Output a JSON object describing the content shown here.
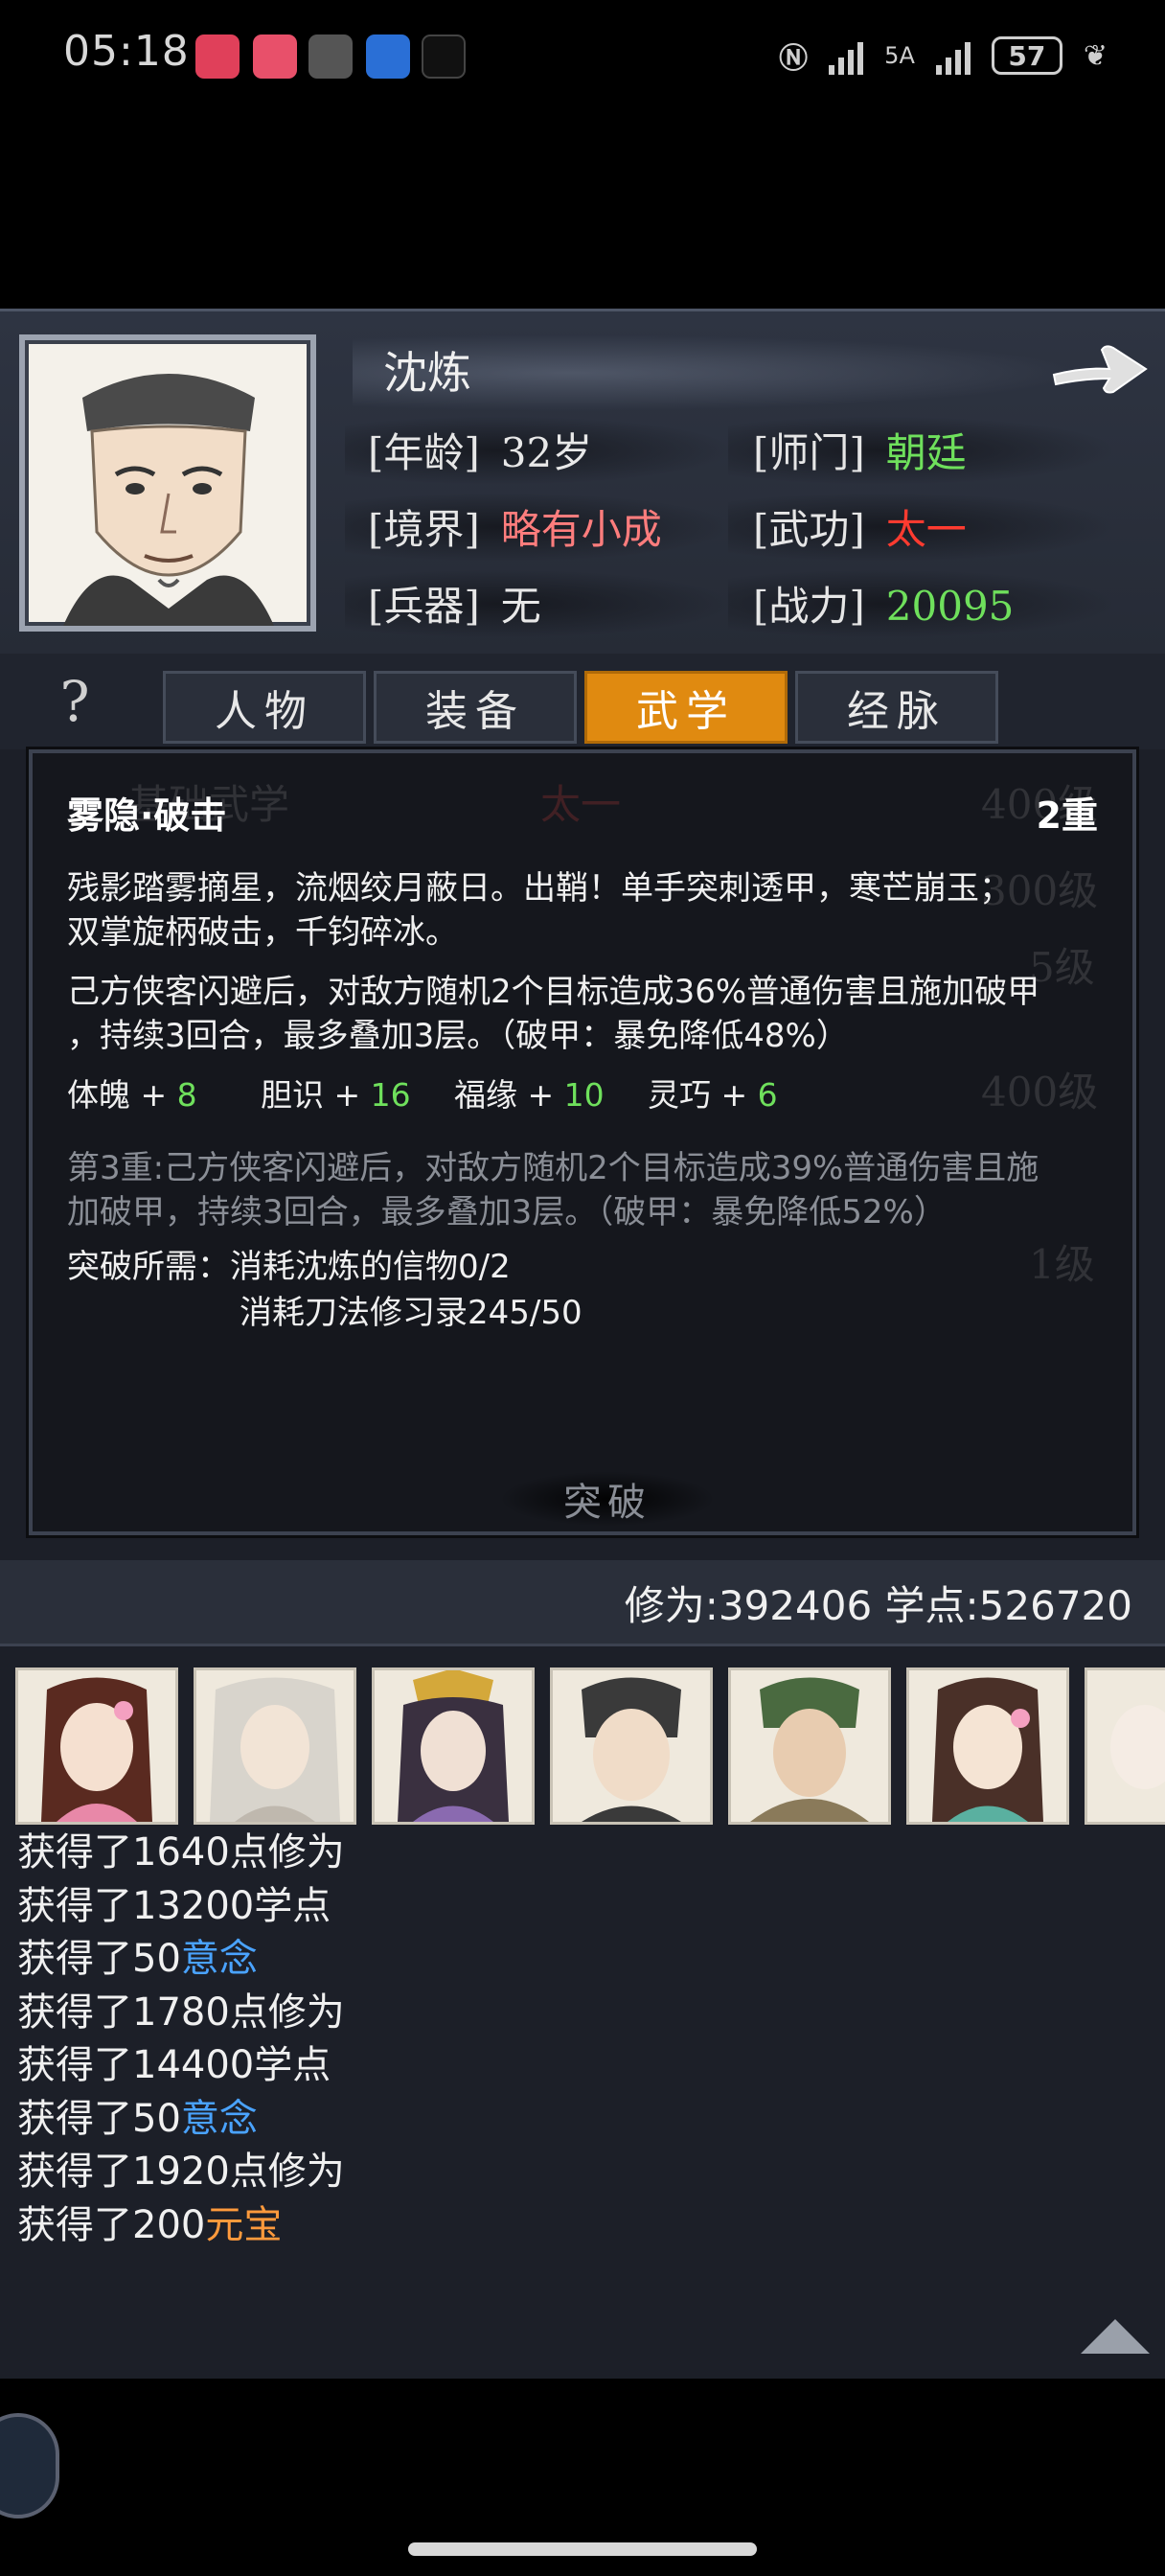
{
  "status": {
    "time": "05:18",
    "battery": "57",
    "network": "5A"
  },
  "character": {
    "name": "沈炼",
    "stats": [
      {
        "label": "[年龄]",
        "value": "32岁",
        "color": "#e8e8e8"
      },
      {
        "label": "[师门]",
        "value": "朝廷",
        "color": "#6fe05c"
      },
      {
        "label": "[境界]",
        "value": "略有小成",
        "color": "#ff7d7d"
      },
      {
        "label": "[武功]",
        "value": "太一",
        "color": "#ff3b30"
      },
      {
        "label": "[兵器]",
        "value": "无",
        "color": "#e8e8e8"
      },
      {
        "label": "[战力]",
        "value": "20095",
        "color": "#6fe05c"
      }
    ]
  },
  "help": {
    "glyph": "?"
  },
  "tabs": [
    {
      "label": "人物",
      "active": false
    },
    {
      "label": "装备",
      "active": false
    },
    {
      "label": "武学",
      "active": true
    },
    {
      "label": "经脉",
      "active": false
    }
  ],
  "skill": {
    "title": "雾隐·破击",
    "level": "2重",
    "poem_line1": "残影踏雾摘星，流烟绞月蔽日。出鞘！单手突刺透甲，寒芒崩玉；",
    "poem_line2": "双掌旋柄破击，千钧碎冰。",
    "effect_line1": "己方侠客闪避后，对敌方随机2个目标造成36%普通伤害且施加破甲",
    "effect_line2": "，持续3回合，最多叠加3层。（破甲：暴免降低48%）",
    "attrs": [
      {
        "name": "体魄 + ",
        "value": "8"
      },
      {
        "name": "胆识 + ",
        "value": "16"
      },
      {
        "name": "福缘 + ",
        "value": "10"
      },
      {
        "name": "灵巧 + ",
        "value": "6"
      }
    ],
    "next_line1": "第3重:己方侠客闪避后，对敌方随机2个目标造成39%普通伤害且施",
    "next_line2": "加破甲，持续3回合，最多叠加3层。（破甲：暴免降低52%）",
    "req_label": "突破所需：",
    "req_line1": "消耗沈炼的信物0/2",
    "req_line2": "消耗刀法修习录245/50",
    "button": "突破"
  },
  "points": {
    "text": "修为:392406  学点:526720"
  },
  "log": [
    {
      "text": "获得了1640点修为",
      "highlight": ""
    },
    {
      "text": "获得了13200学点",
      "highlight": ""
    },
    {
      "text": "获得了50",
      "highlight": "意念",
      "color": "blue"
    },
    {
      "text": "获得了1780点修为",
      "highlight": ""
    },
    {
      "text": "获得了14400学点",
      "highlight": ""
    },
    {
      "text": "获得了50",
      "highlight": "意念",
      "color": "blue"
    },
    {
      "text": "获得了1920点修为",
      "highlight": ""
    },
    {
      "text": "获得了200",
      "highlight": "元宝",
      "color": "orange"
    }
  ]
}
